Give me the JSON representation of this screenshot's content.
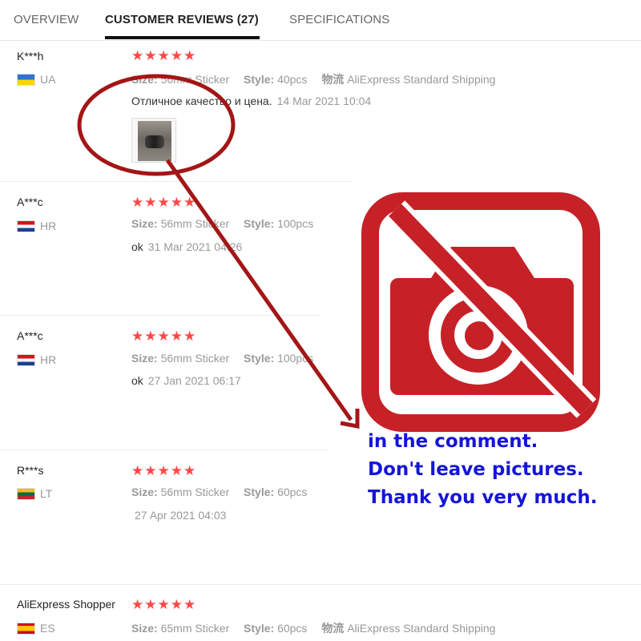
{
  "tabs": [
    {
      "label": "OVERVIEW",
      "active": false
    },
    {
      "label": "CUSTOMER REVIEWS (27)",
      "active": true
    },
    {
      "label": "SPECIFICATIONS",
      "active": false
    }
  ],
  "reviews": [
    {
      "name": "K***h",
      "country": "UA",
      "stars": "★★★★★",
      "size_label": "Size:",
      "size": "56mm Sticker",
      "style_label": "Style:",
      "style": "40pcs",
      "ship_label": "物流",
      "ship": "AliExpress Standard Shipping",
      "comment": "Отличное качество и цена.",
      "date": "14 Mar 2021 10:04"
    },
    {
      "name": "A***c",
      "country": "HR",
      "stars": "★★★★★",
      "size_label": "Size:",
      "size": "56mm Sticker",
      "style_label": "Style:",
      "style": "100pcs",
      "comment": "ok",
      "date": "31 Mar 2021 04:26"
    },
    {
      "name": "A***c",
      "country": "HR",
      "stars": "★★★★★",
      "size_label": "Size:",
      "size": "56mm Sticker",
      "style_label": "Style:",
      "style": "100pcs",
      "comment": "ok",
      "date": "27 Jan 2021 06:17"
    },
    {
      "name": "R***s",
      "country": "LT",
      "stars": "★★★★★",
      "size_label": "Size:",
      "size": "56mm Sticker",
      "style_label": "Style:",
      "style": "60pcs",
      "comment": "",
      "date": "27 Apr 2021 04:03"
    },
    {
      "name": "AliExpress Shopper",
      "country": "ES",
      "stars": "★★★★★",
      "size_label": "Size:",
      "size": "65mm Sticker",
      "style_label": "Style:",
      "style": "60pcs",
      "ship_label": "物流",
      "ship": "AliExpress Standard Shipping"
    }
  ],
  "notice": {
    "line1": "in the comment.",
    "line2": "Don't leave pictures.",
    "line3": "Thank you very much."
  },
  "colors": {
    "star": "#ff4747",
    "annotation_red": "#a31616",
    "no_camera_red": "#c62127",
    "notice_blue": "#1515d8"
  },
  "icons": [
    "no-camera-icon",
    "star-icon"
  ]
}
